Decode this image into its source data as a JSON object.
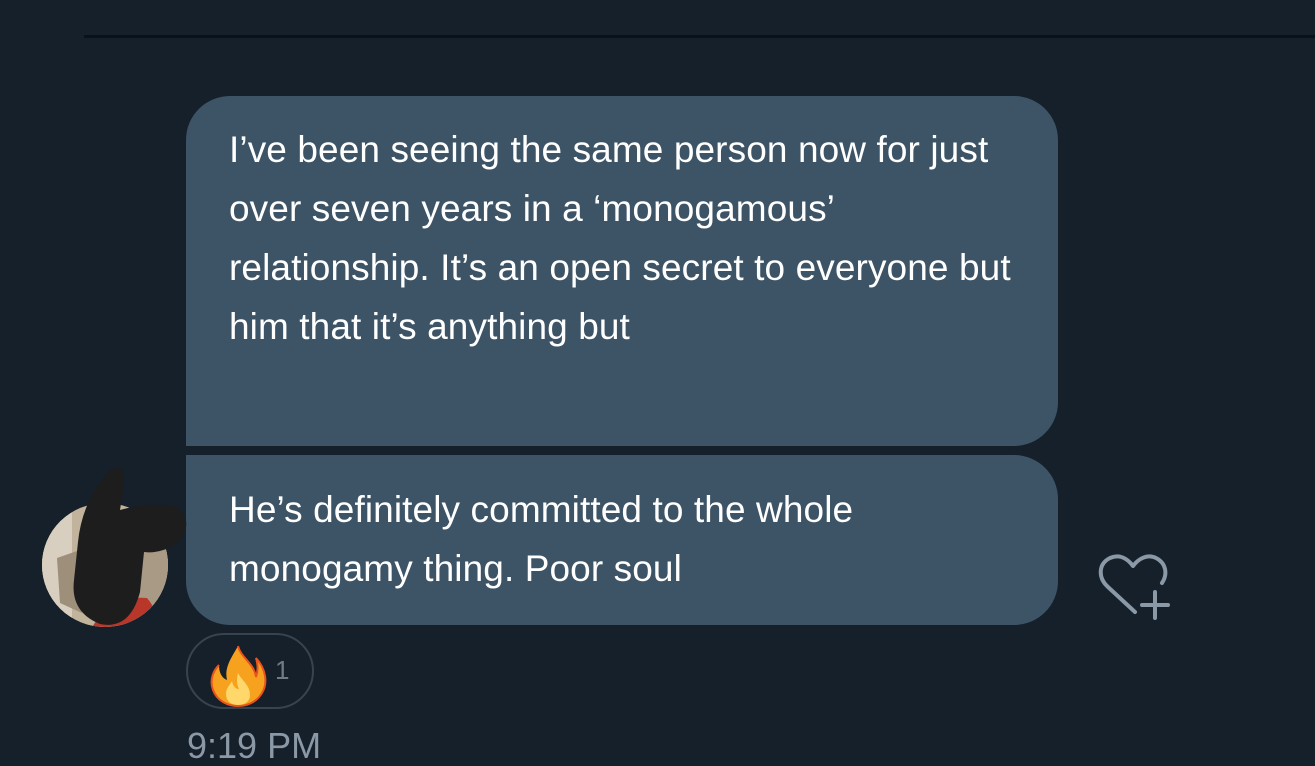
{
  "conversation": {
    "messages": [
      {
        "text": "I’ve been seeing the same person now for just over seven years in a ‘monogamous’ relationship. It’s an open secret to everyone but him that it’s anything but"
      },
      {
        "text": "He’s definitely committed to the whole monogamy thing. Poor soul"
      }
    ],
    "reaction": {
      "emoji_icon": "fire-emoji",
      "count": "1"
    },
    "timestamp": "9:19 PM"
  },
  "colors": {
    "background": "#15202b",
    "bubble": "#3d5466",
    "message_text": "#ffffff",
    "muted_text": "#8b98a5"
  }
}
